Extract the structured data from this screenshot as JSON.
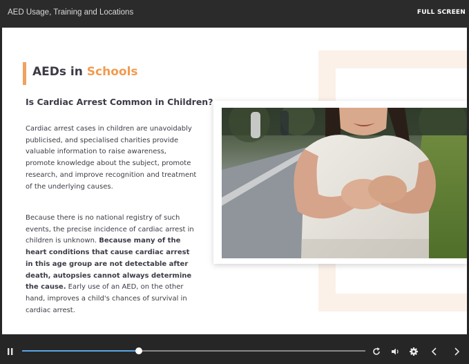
{
  "window": {
    "title": "AED Usage, Training and Locations",
    "fullscreen_label": "FULL SCREEN"
  },
  "slide": {
    "heading_main": "AEDs in ",
    "heading_highlight": "Schools",
    "subheading": "Is Cardiac Arrest Common in Children?",
    "paragraph1": "Cardiac arrest cases in children are unavoidably publicised, and specialised charities provide valuable information to raise awareness, promote knowledge about the subject, promote research, and improve recognition and treatment of the underlying causes.",
    "paragraph2_start": "Because there is no national registry of such events, the precise incidence of cardiac arrest in children is unknown. ",
    "paragraph2_bold": "Because many of the heart conditions that cause cardiac arrest in this age group are not detectable after death, autopsies cannot always determine the cause.",
    "paragraph2_end": " Early use of an AED, on the other hand, improves a child's chances of survival in cardiac arrest.",
    "accent_color": "#f29b4e"
  },
  "player": {
    "progress_fraction": 0.34,
    "icons": [
      "pause-icon",
      "replay-icon",
      "volume-icon",
      "settings-icon",
      "previous-icon",
      "next-icon"
    ]
  }
}
